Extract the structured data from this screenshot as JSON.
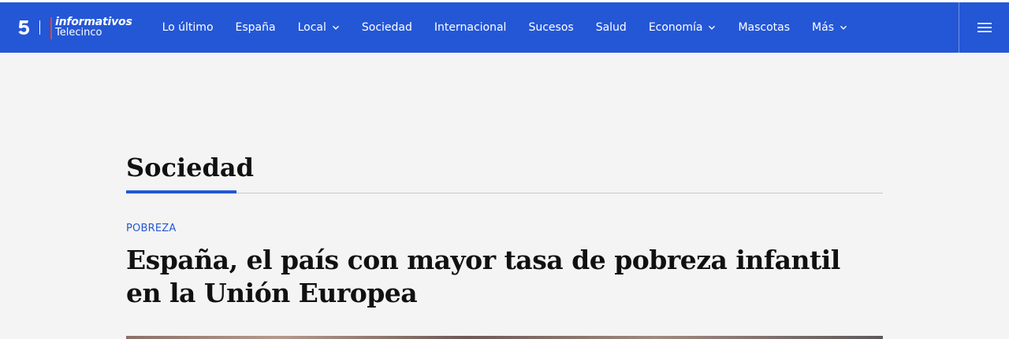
{
  "brand": {
    "logo_icon": "telecinco-five-icon",
    "top": "informativos",
    "bottom": "Telecinco"
  },
  "nav": {
    "items": [
      {
        "label": "Lo último",
        "dropdown": false
      },
      {
        "label": "España",
        "dropdown": false
      },
      {
        "label": "Local",
        "dropdown": true
      },
      {
        "label": "Sociedad",
        "dropdown": false
      },
      {
        "label": "Internacional",
        "dropdown": false
      },
      {
        "label": "Sucesos",
        "dropdown": false
      },
      {
        "label": "Salud",
        "dropdown": false
      },
      {
        "label": "Economía",
        "dropdown": true
      },
      {
        "label": "Mascotas",
        "dropdown": false
      },
      {
        "label": "Más",
        "dropdown": true
      }
    ],
    "menu_icon": "hamburger-menu-icon"
  },
  "section": {
    "title": "Sociedad"
  },
  "article": {
    "kicker": "POBREZA",
    "headline": "España, el país con mayor tasa de pobreza infantil en la Unión Europea"
  },
  "colors": {
    "brand_blue": "#2457d6",
    "brand_red": "#e8443a",
    "background": "#f4f4f4",
    "text": "#111111"
  }
}
